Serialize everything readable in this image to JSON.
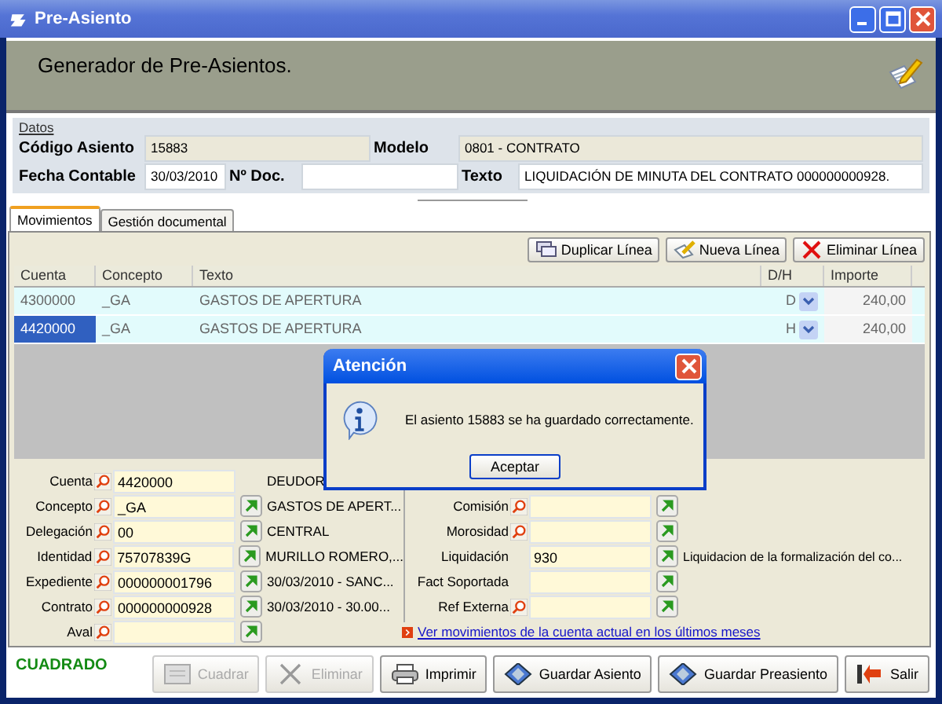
{
  "window": {
    "title": "Pre-Asiento"
  },
  "header": {
    "title": "Generador de Pre-Asientos."
  },
  "datos": {
    "legend": "Datos",
    "rows": [
      [
        {
          "label": "Código Asiento",
          "value": "15883",
          "kind": "readonly"
        },
        {
          "label": "Modelo",
          "value": "0801 - CONTRATO",
          "kind": "readonly"
        }
      ],
      [
        {
          "label": "Fecha Contable",
          "value": "30/03/2010",
          "kind": "date"
        },
        {
          "label": "Nº Doc.",
          "kind": "input"
        },
        {
          "label": "Texto",
          "value": "LIQUIDACIÓN DE MINUTA DEL CONTRATO 000000000928.",
          "kind": "input"
        }
      ]
    ]
  },
  "tabs": [
    {
      "label": "Movimientos",
      "selected": true
    },
    {
      "label": "Gestión documental",
      "selected": false
    }
  ],
  "toolbar": [
    {
      "label": "Duplicar Línea",
      "kind": "duplicate"
    },
    {
      "label": "Nueva Línea",
      "kind": "new"
    },
    {
      "label": "Eliminar Línea",
      "kind": "delete"
    }
  ],
  "table": {
    "columns": [
      "Cuenta",
      "Concepto",
      "Texto",
      "D/H",
      "Importe"
    ],
    "rows": [
      {
        "cells": [
          "4300000",
          "_GA",
          "GASTOS DE APERTURA",
          "D",
          "240,00"
        ],
        "selected": false
      },
      {
        "cells": [
          "4420000",
          "_GA",
          "GASTOS DE APERTURA",
          "H",
          "240,00"
        ],
        "selected": true
      }
    ]
  },
  "form_left": [
    {
      "label": "Cuenta",
      "lookup": true,
      "value": "4420000",
      "button": false,
      "description": "DEUDOR"
    },
    {
      "label": "Concepto",
      "lookup": true,
      "value": "_GA",
      "button": true,
      "description": "GASTOS DE APERT..."
    },
    {
      "label": "Delegación",
      "lookup": true,
      "value": "00",
      "button": true,
      "description": "CENTRAL"
    },
    {
      "label": "Identidad",
      "lookup": true,
      "value": "75707839G",
      "button": true,
      "description": "MURILLO ROMERO,..."
    },
    {
      "label": "Expediente",
      "lookup": true,
      "value": "000000001796",
      "button": true,
      "description": "30/03/2010 - SANC..."
    },
    {
      "label": "Contrato",
      "lookup": true,
      "value": "000000000928",
      "button": true,
      "description": "30/03/2010 - 30.00..."
    },
    {
      "label": "Aval",
      "lookup": true,
      "button": true
    }
  ],
  "form_right": [
    {
      "label": "Comisión",
      "lookup": true
    },
    {
      "label": "Morosidad",
      "lookup": true
    },
    {
      "label": "Liquidación",
      "lookup": false,
      "value": "930",
      "description": "Liquidacion de la formalización del co..."
    },
    {
      "label": "Fact Soportada",
      "lookup": false
    },
    {
      "label": "Ref Externa",
      "lookup": true
    }
  ],
  "link": "Ver movimientos de la cuenta actual en los últimos meses",
  "status": "CUADRADO",
  "buttons": [
    {
      "label": "Cuadrar",
      "kind": "balance",
      "disabled": true
    },
    {
      "label": "Eliminar",
      "kind": "delete",
      "disabled": true
    },
    {
      "label": "Imprimir",
      "kind": "print",
      "disabled": false
    },
    {
      "label": "Guardar Asiento",
      "kind": "save",
      "disabled": false
    },
    {
      "label": "Guardar Preasiento",
      "kind": "save",
      "disabled": false
    },
    {
      "label": "Salir",
      "kind": "exit",
      "disabled": false
    }
  ],
  "dialog": {
    "title": "Atención",
    "message": "El asiento 15883 se ha guardado correctamente.",
    "button": "Aceptar"
  }
}
